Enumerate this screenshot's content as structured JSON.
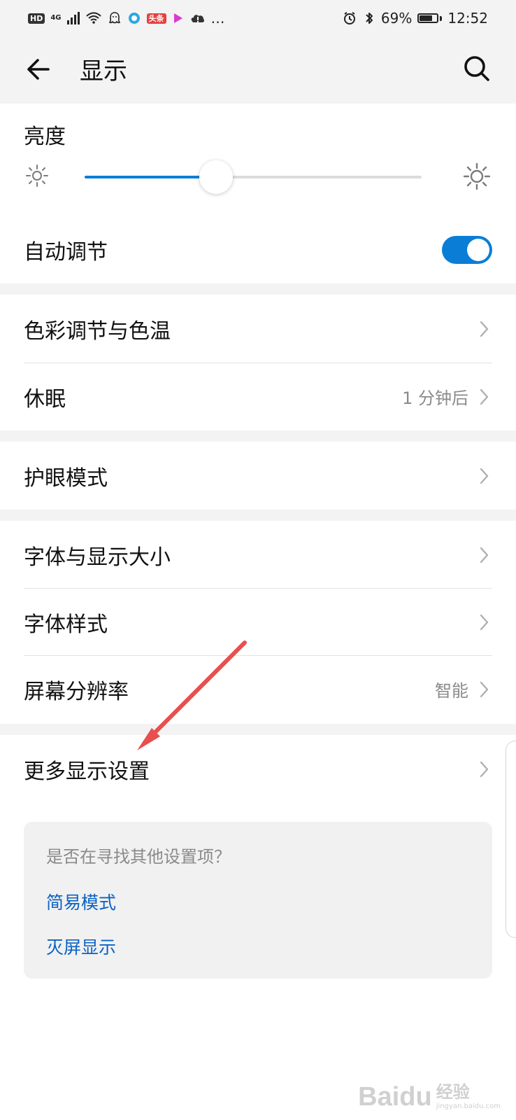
{
  "status_bar": {
    "hd_label": "HD",
    "network_label": "4G",
    "app_badge_label": "头条",
    "more_label": "…",
    "battery_text": "69%",
    "time": "12:52"
  },
  "header": {
    "title": "显示",
    "back_icon": "arrow-left-icon",
    "search_icon": "search-icon"
  },
  "brightness": {
    "label": "亮度",
    "value_percent": 39,
    "accent_color": "#0a7ed6"
  },
  "auto_adjust": {
    "label": "自动调节",
    "enabled": true
  },
  "groups": {
    "color": {
      "label": "色彩调节与色温"
    },
    "sleep": {
      "label": "休眠",
      "value": "1 分钟后"
    },
    "eye_care": {
      "label": "护眼模式"
    },
    "font_size": {
      "label": "字体与显示大小"
    },
    "font_style": {
      "label": "字体样式"
    },
    "resolution": {
      "label": "屏幕分辨率",
      "value": "智能"
    },
    "more_display": {
      "label": "更多显示设置"
    }
  },
  "suggestions": {
    "title": "是否在寻找其他设置项？",
    "items": [
      {
        "label": "简易模式"
      },
      {
        "label": "灭屏显示"
      }
    ]
  },
  "watermark": {
    "brand": "Baidu",
    "cn": "经验",
    "url": "jingyan.baidu.com"
  }
}
